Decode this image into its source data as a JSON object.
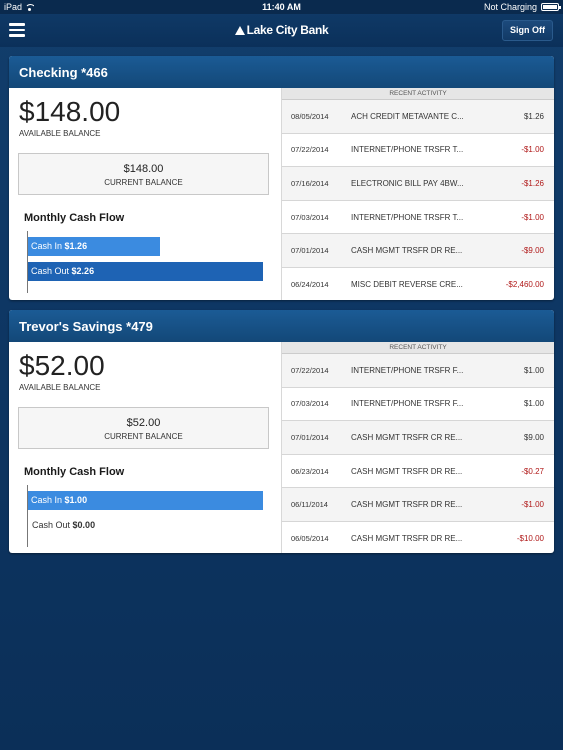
{
  "statusbar": {
    "device": "iPad",
    "time": "11:40 AM",
    "charging": "Not Charging"
  },
  "navbar": {
    "brand": "Lake City Bank",
    "signoff_label": "Sign Off"
  },
  "accounts": [
    {
      "title": "Checking *466",
      "available_balance": "$148.00",
      "available_label": "AVAILABLE BALANCE",
      "current_balance": "$148.00",
      "current_label": "CURRENT BALANCE",
      "cashflow_title": "Monthly Cash Flow",
      "cash_in_label": "Cash In",
      "cash_in_value": "$1.26",
      "cash_in_fraction": 0.56,
      "cash_out_label": "Cash Out",
      "cash_out_value": "$2.26",
      "cash_out_fraction": 1.0,
      "recent_label": "RECENT ACTIVITY",
      "transactions": [
        {
          "date": "08/05/2014",
          "desc": "ACH CREDIT METAVANTE C...",
          "amount": "$1.26",
          "negative": false
        },
        {
          "date": "07/22/2014",
          "desc": "INTERNET/PHONE TRSFR T...",
          "amount": "-$1.00",
          "negative": true
        },
        {
          "date": "07/16/2014",
          "desc": "ELECTRONIC BILL PAY 4BW...",
          "amount": "-$1.26",
          "negative": true
        },
        {
          "date": "07/03/2014",
          "desc": "INTERNET/PHONE TRSFR T...",
          "amount": "-$1.00",
          "negative": true
        },
        {
          "date": "07/01/2014",
          "desc": "CASH MGMT TRSFR DR RE...",
          "amount": "-$9.00",
          "negative": true
        },
        {
          "date": "06/24/2014",
          "desc": "MISC DEBIT REVERSE CRE...",
          "amount": "-$2,460.00",
          "negative": true
        }
      ]
    },
    {
      "title": "Trevor's Savings *479",
      "available_balance": "$52.00",
      "available_label": "AVAILABLE BALANCE",
      "current_balance": "$52.00",
      "current_label": "CURRENT BALANCE",
      "cashflow_title": "Monthly Cash Flow",
      "cash_in_label": "Cash In",
      "cash_in_value": "$1.00",
      "cash_in_fraction": 1.0,
      "cash_out_label": "Cash Out",
      "cash_out_value": "$0.00",
      "cash_out_fraction": 0.0,
      "recent_label": "RECENT ACTIVITY",
      "transactions": [
        {
          "date": "07/22/2014",
          "desc": "INTERNET/PHONE TRSFR F...",
          "amount": "$1.00",
          "negative": false
        },
        {
          "date": "07/03/2014",
          "desc": "INTERNET/PHONE TRSFR F...",
          "amount": "$1.00",
          "negative": false
        },
        {
          "date": "07/01/2014",
          "desc": "CASH MGMT TRSFR CR RE...",
          "amount": "$9.00",
          "negative": false
        },
        {
          "date": "06/23/2014",
          "desc": "CASH MGMT TRSFR DR RE...",
          "amount": "-$0.27",
          "negative": true
        },
        {
          "date": "06/11/2014",
          "desc": "CASH MGMT TRSFR DR RE...",
          "amount": "-$1.00",
          "negative": true
        },
        {
          "date": "06/05/2014",
          "desc": "CASH MGMT TRSFR DR RE...",
          "amount": "-$10.00",
          "negative": true
        }
      ]
    }
  ]
}
